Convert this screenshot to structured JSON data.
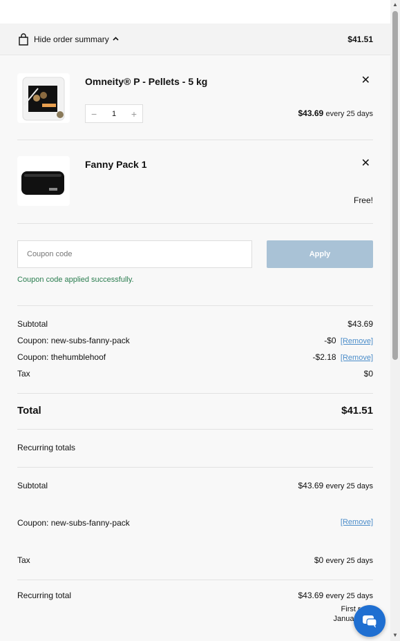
{
  "summary_bar": {
    "toggle_label": "Hide order summary",
    "order_total": "$41.51"
  },
  "items": [
    {
      "name": "Omneity® P - Pellets - 5 kg",
      "quantity": "1",
      "price": "$43.69",
      "price_suffix": "every 25 days",
      "remove_icon": "close-icon"
    },
    {
      "name": "Fanny Pack  1",
      "price": "Free!",
      "remove_icon": "close-icon"
    }
  ],
  "coupon": {
    "placeholder": "Coupon code",
    "apply_label": "Apply",
    "success_message": "Coupon code applied successfully."
  },
  "totals": {
    "subtotal_label": "Subtotal",
    "subtotal_value": "$43.69",
    "coupon1_label": "Coupon: new-subs-fanny-pack",
    "coupon1_value": "-$0",
    "coupon2_label": "Coupon: thehumblehoof",
    "coupon2_value": "-$2.18",
    "remove_label": "[Remove]",
    "tax_label": "Tax",
    "tax_value": "$0",
    "total_label": "Total",
    "total_value": "$41.51"
  },
  "recurring": {
    "heading": "Recurring totals",
    "subtotal_label": "Subtotal",
    "subtotal_value": "$43.69",
    "period": "every 25 days",
    "coupon_label": "Coupon: new-subs-fanny-pack",
    "remove_label": "[Remove]",
    "tax_label": "Tax",
    "tax_value": "$0",
    "total_label": "Recurring total",
    "total_value": "$43.69",
    "renewal_line1": "First rene",
    "renewal_line2": "January 30,"
  },
  "colors": {
    "accent": "#1f6fd1",
    "apply_button": "#a9c2d6",
    "success": "#2a7d4f",
    "link": "#4a8cc9"
  }
}
